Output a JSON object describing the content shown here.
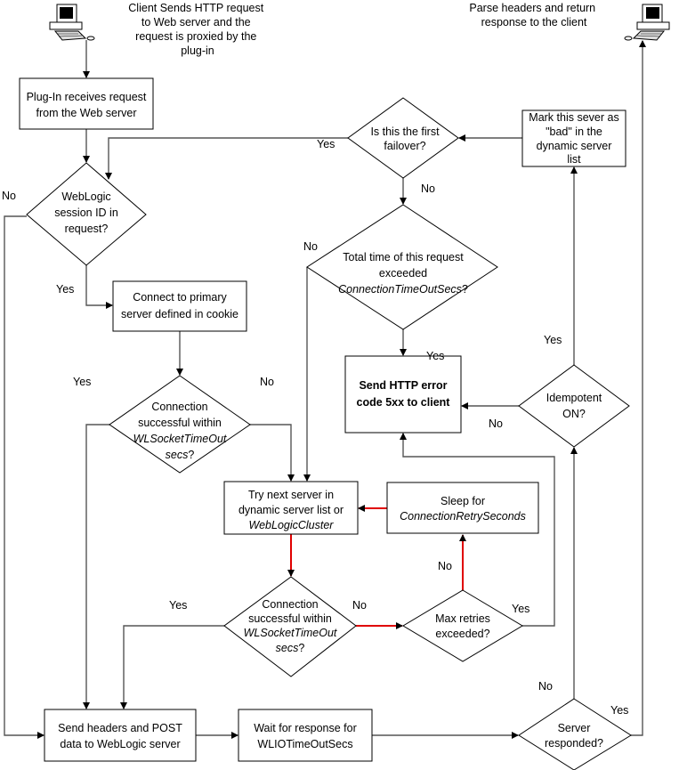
{
  "colors": {
    "retry_path": "#e00000",
    "line": "#555555",
    "shape_border": "#000000"
  },
  "client_start": {
    "icon": "computer-icon",
    "lines": [
      "Client Sends HTTP request",
      "to Web server and the",
      "request is proxied by the",
      "plug-in"
    ]
  },
  "client_end": {
    "icon": "computer-icon",
    "lines": [
      "Parse headers and return",
      "response to the client"
    ]
  },
  "nodes": {
    "plugin_receives": [
      "Plug-In receives request",
      "from the Web server"
    ],
    "session_id": [
      "WebLogic",
      "session ID in",
      "request?"
    ],
    "connect_primary": [
      "Connect to primary",
      "server defined in cookie"
    ],
    "conn_success_1": [
      "Connection",
      "successful within",
      "WLSocketTimeOut",
      "secs",
      "?"
    ],
    "first_failover": [
      "Is this the first",
      "failover?"
    ],
    "mark_bad": [
      "Mark this sever as",
      "\"bad\" in the",
      "dynamic server",
      "list"
    ],
    "total_time": [
      "Total time of this request",
      "exceeded",
      "ConnectionTimeOutSecs",
      "?"
    ],
    "send_error": [
      "Send HTTP error",
      "code 5xx to client"
    ],
    "idempotent": [
      "Idempotent",
      "ON?"
    ],
    "try_next": [
      "Try next server in",
      "dynamic server list or",
      "WebLogicCluster"
    ],
    "sleep": [
      "Sleep for",
      "ConnectionRetrySeconds"
    ],
    "conn_success_2": [
      "Connection",
      "successful within",
      "WLSocketTimeOut",
      "secs",
      "?"
    ],
    "max_retries": [
      "Max retries",
      "exceeded?"
    ],
    "send_headers": [
      "Send headers and POST",
      "data to WebLogic server"
    ],
    "wait_response": [
      "Wait for response for",
      "WLIOTimeOutSecs"
    ],
    "server_responded": [
      "Server",
      "responded?"
    ]
  },
  "edge_labels": {
    "session_no": "No",
    "session_yes": "Yes",
    "first_failover_yes": "Yes",
    "first_failover_no": "No",
    "total_time_no": "No",
    "total_time_yes": "Yes",
    "conn1_yes": "Yes",
    "conn1_no": "No",
    "idempotent_yes": "Yes",
    "idempotent_no": "No",
    "conn2_yes": "Yes",
    "conn2_no": "No",
    "max_retries_no": "No",
    "max_retries_yes": "Yes",
    "responded_no": "No",
    "responded_yes": "Yes"
  }
}
